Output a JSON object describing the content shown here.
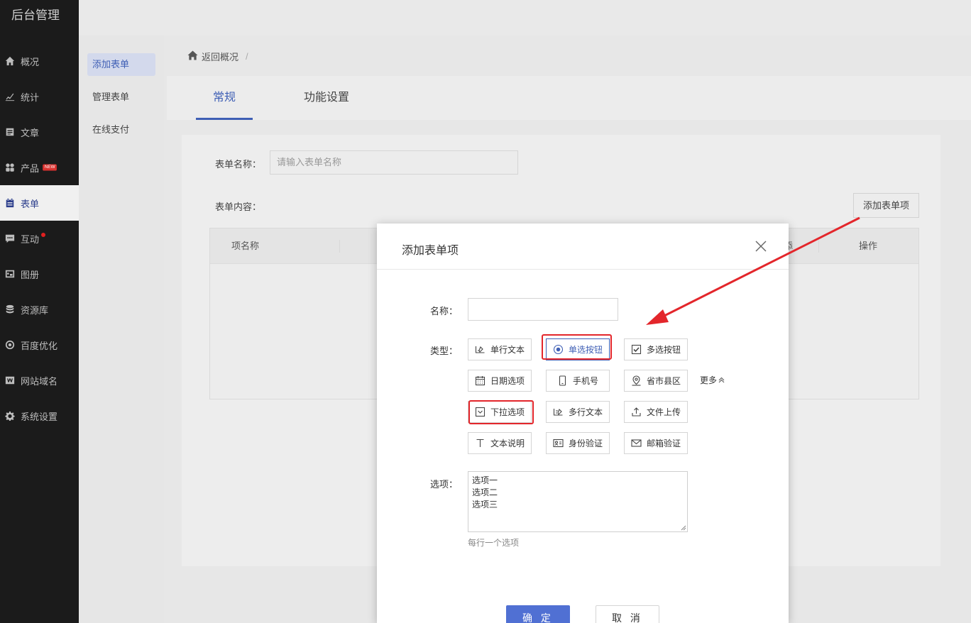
{
  "brand": "后台管理",
  "sidebar": {
    "items": [
      {
        "label": "概况",
        "icon": "home-icon"
      },
      {
        "label": "统计",
        "icon": "chart-icon"
      },
      {
        "label": "文章",
        "icon": "article-icon"
      },
      {
        "label": "产品",
        "icon": "apps-icon",
        "badge": "NEW"
      },
      {
        "label": "表单",
        "icon": "form-icon",
        "active": true
      },
      {
        "label": "互动",
        "icon": "chat-icon"
      },
      {
        "label": "图册",
        "icon": "album-icon"
      },
      {
        "label": "资源库",
        "icon": "database-icon"
      },
      {
        "label": "百度优化",
        "icon": "seo-icon"
      },
      {
        "label": "网站域名",
        "icon": "domain-icon"
      },
      {
        "label": "系统设置",
        "icon": "gear-icon"
      }
    ]
  },
  "subnav": {
    "items": [
      {
        "label": "添加表单",
        "active": true
      },
      {
        "label": "管理表单"
      },
      {
        "label": "在线支付"
      }
    ]
  },
  "breadcrumb": {
    "back": "返回概况",
    "separator": "/"
  },
  "tabs": [
    {
      "label": "常规",
      "active": true
    },
    {
      "label": "功能设置"
    }
  ],
  "form": {
    "name_label": "表单名称：",
    "name_placeholder": "请输入表单名称",
    "content_label": "表单内容：",
    "add_item_button": "添加表单项",
    "table_headers": {
      "col1": "项名称",
      "col_partial": "添",
      "col_op": "操作"
    }
  },
  "modal": {
    "title": "添加表单项",
    "name_label": "名称：",
    "name_value": "",
    "type_label": "类型：",
    "types": [
      {
        "label": "单行文本",
        "icon": "single-line-icon"
      },
      {
        "label": "单选按钮",
        "icon": "radio-icon",
        "selected": true
      },
      {
        "label": "多选按钮",
        "icon": "checkbox-icon"
      },
      {
        "label": "日期选项",
        "icon": "calendar-icon"
      },
      {
        "label": "手机号",
        "icon": "phone-icon"
      },
      {
        "label": "省市县区",
        "icon": "location-icon"
      },
      {
        "label": "下拉选项",
        "icon": "dropdown-icon"
      },
      {
        "label": "多行文本",
        "icon": "multi-line-icon"
      },
      {
        "label": "文件上传",
        "icon": "upload-icon"
      },
      {
        "label": "文本说明",
        "icon": "text-icon"
      },
      {
        "label": "身份验证",
        "icon": "id-card-icon"
      },
      {
        "label": "邮箱验证",
        "icon": "mail-icon"
      }
    ],
    "more_label": "更多",
    "options_label": "选项：",
    "options_lines": [
      "选项一",
      "选项二",
      "选项三"
    ],
    "options_hint": "每行一个选项",
    "ok_button": "确 定",
    "cancel_button": "取 消"
  },
  "colors": {
    "accent": "#3f5fb5",
    "primary_button": "#5070d3",
    "highlight": "#e3262b",
    "sidebar_bg": "#1b1b1b"
  }
}
